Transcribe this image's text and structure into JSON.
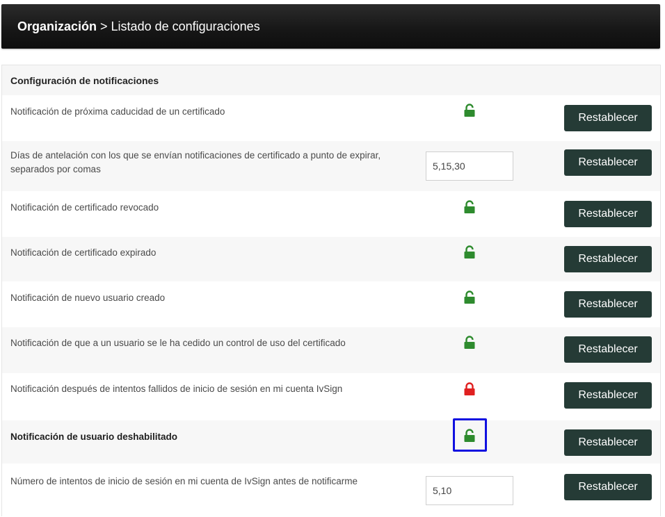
{
  "breadcrumb": {
    "root": "Organización",
    "separator": ">",
    "current": "Listado de configuraciones"
  },
  "section": {
    "title": "Configuración de notificaciones"
  },
  "rows": [
    {
      "label": "Notificación de próxima caducidad de un certificado",
      "control": "lock",
      "lock_state": "unlocked",
      "lock_color": "#2e8b2e",
      "button": "Restablecer"
    },
    {
      "label": "Días de antelación con los que se envían notificaciones de certificado a punto de expirar, separados por comas",
      "control": "input",
      "value": "5,15,30",
      "button": "Restablecer"
    },
    {
      "label": "Notificación de certificado revocado",
      "control": "lock",
      "lock_state": "unlocked",
      "lock_color": "#2e8b2e",
      "button": "Restablecer"
    },
    {
      "label": "Notificación de certificado expirado",
      "control": "lock",
      "lock_state": "unlocked",
      "lock_color": "#2e8b2e",
      "button": "Restablecer"
    },
    {
      "label": "Notificación de nuevo usuario creado",
      "control": "lock",
      "lock_state": "unlocked",
      "lock_color": "#2e8b2e",
      "button": "Restablecer"
    },
    {
      "label": "Notificación de que a un usuario se le ha cedido un control de uso del certificado",
      "control": "lock",
      "lock_state": "unlocked",
      "lock_color": "#2e8b2e",
      "button": "Restablecer"
    },
    {
      "label": "Notificación después de intentos fallidos de inicio de sesión en mi cuenta IvSign",
      "control": "lock",
      "lock_state": "locked",
      "lock_color": "#e02020",
      "button": "Restablecer"
    },
    {
      "label": "Notificación de usuario deshabilitado",
      "control": "lock",
      "lock_state": "unlocked",
      "lock_color": "#2e8b2e",
      "highlighted": true,
      "button": "Restablecer"
    },
    {
      "label": "Número de intentos de inicio de sesión en mi cuenta de IvSign antes de notificarme",
      "control": "input",
      "value": "5,10",
      "button": "Restablecer"
    }
  ],
  "colors": {
    "header_bg": "#161616",
    "button_bg": "#253b36",
    "unlocked_green": "#2e8b2e",
    "locked_red": "#e02020",
    "highlight_border": "#1010e0"
  }
}
